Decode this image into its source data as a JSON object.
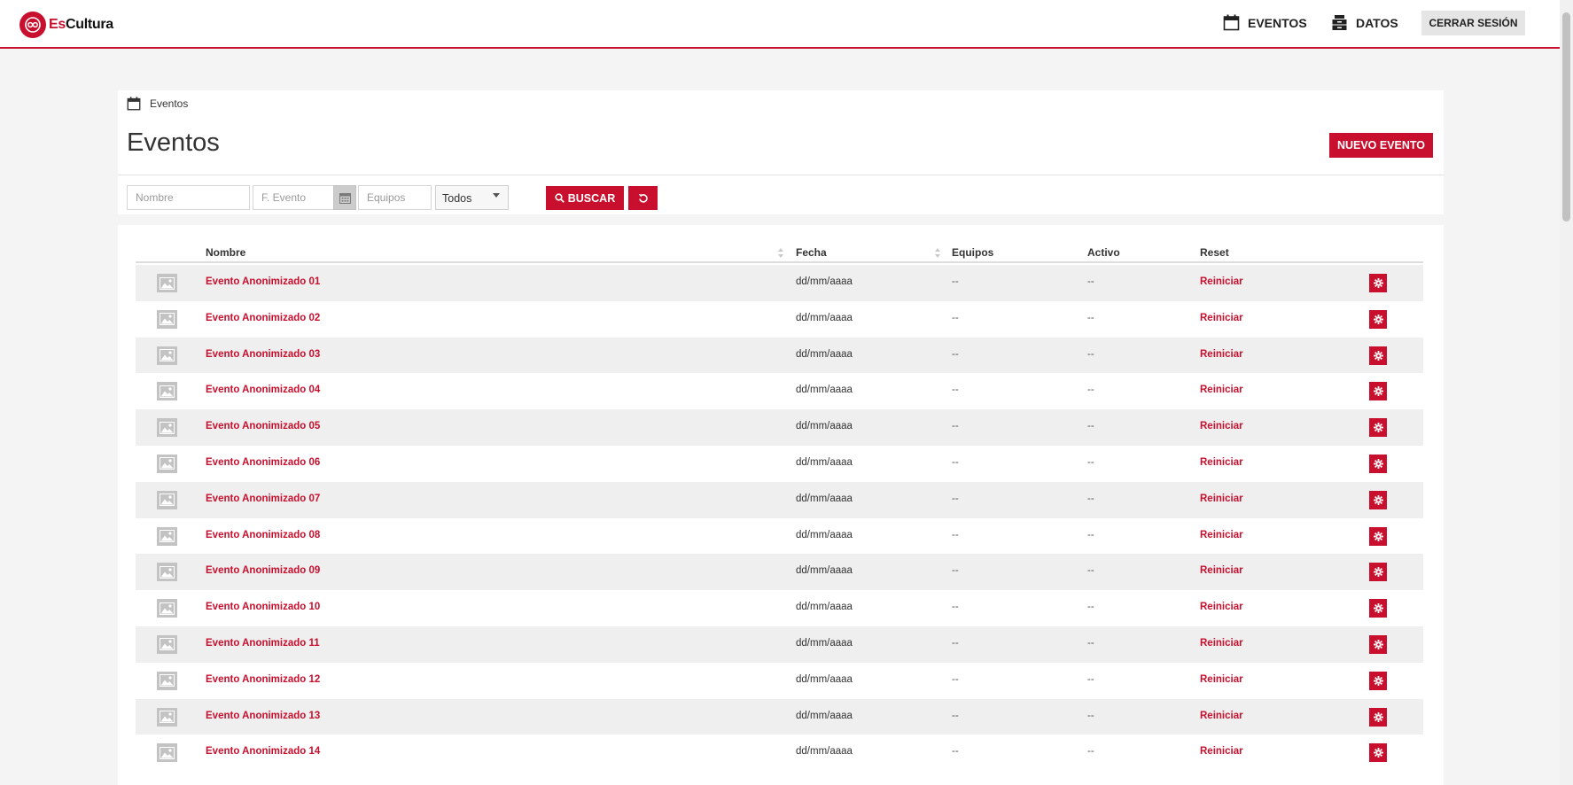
{
  "app": {
    "logo_es": "Es",
    "logo_cultura": "Cultura",
    "nav": [
      {
        "label": "EVENTOS",
        "icon": "calendar-icon"
      },
      {
        "label": "DATOS",
        "icon": "database-icon"
      }
    ],
    "logout_label": "CERRAR SESIÓN",
    "accent_color": "#c8102e"
  },
  "breadcrumb": {
    "label": "Eventos",
    "icon": "calendar-icon"
  },
  "page": {
    "title": "Eventos",
    "new_button_label": "NUEVO EVENTO"
  },
  "filters": {
    "nombre_placeholder": "Nombre",
    "fecha_placeholder": "F. Evento",
    "equipos_placeholder": "Equipos",
    "estado_selected": "Todos",
    "search_label": "BUSCAR"
  },
  "table": {
    "columns": [
      "Nombre",
      "Fecha",
      "Equipos",
      "Activo",
      "Reset"
    ],
    "rows": [
      {
        "nombre": "Evento Anonimizado 01",
        "fecha": "dd/mm/aaaa",
        "equipos": "--",
        "activo": "--",
        "reset": "Reiniciar"
      },
      {
        "nombre": "Evento Anonimizado 02",
        "fecha": "dd/mm/aaaa",
        "equipos": "--",
        "activo": "--",
        "reset": "Reiniciar"
      },
      {
        "nombre": "Evento Anonimizado 03",
        "fecha": "dd/mm/aaaa",
        "equipos": "--",
        "activo": "--",
        "reset": "Reiniciar"
      },
      {
        "nombre": "Evento Anonimizado 04",
        "fecha": "dd/mm/aaaa",
        "equipos": "--",
        "activo": "--",
        "reset": "Reiniciar"
      },
      {
        "nombre": "Evento Anonimizado 05",
        "fecha": "dd/mm/aaaa",
        "equipos": "--",
        "activo": "--",
        "reset": "Reiniciar"
      },
      {
        "nombre": "Evento Anonimizado 06",
        "fecha": "dd/mm/aaaa",
        "equipos": "--",
        "activo": "--",
        "reset": "Reiniciar"
      },
      {
        "nombre": "Evento Anonimizado 07",
        "fecha": "dd/mm/aaaa",
        "equipos": "--",
        "activo": "--",
        "reset": "Reiniciar"
      },
      {
        "nombre": "Evento Anonimizado 08",
        "fecha": "dd/mm/aaaa",
        "equipos": "--",
        "activo": "--",
        "reset": "Reiniciar"
      },
      {
        "nombre": "Evento Anonimizado 09",
        "fecha": "dd/mm/aaaa",
        "equipos": "--",
        "activo": "--",
        "reset": "Reiniciar"
      },
      {
        "nombre": "Evento Anonimizado 10",
        "fecha": "dd/mm/aaaa",
        "equipos": "--",
        "activo": "--",
        "reset": "Reiniciar"
      },
      {
        "nombre": "Evento Anonimizado 11",
        "fecha": "dd/mm/aaaa",
        "equipos": "--",
        "activo": "--",
        "reset": "Reiniciar"
      },
      {
        "nombre": "Evento Anonimizado 12",
        "fecha": "dd/mm/aaaa",
        "equipos": "--",
        "activo": "--",
        "reset": "Reiniciar"
      },
      {
        "nombre": "Evento Anonimizado 13",
        "fecha": "dd/mm/aaaa",
        "equipos": "--",
        "activo": "--",
        "reset": "Reiniciar"
      },
      {
        "nombre": "Evento Anonimizado 14",
        "fecha": "dd/mm/aaaa",
        "equipos": "--",
        "activo": "--",
        "reset": "Reiniciar"
      }
    ]
  }
}
